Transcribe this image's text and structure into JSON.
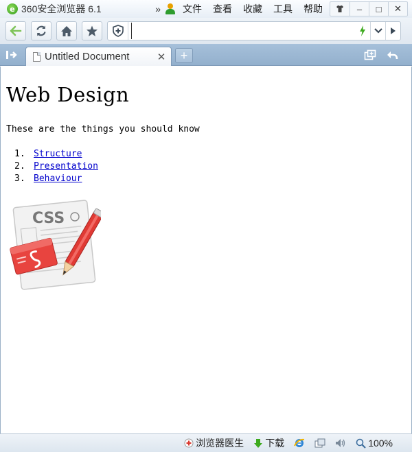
{
  "window": {
    "app_title": "360安全浏览器 6.1",
    "logo_letter": "e",
    "overflow_chevron": "»",
    "menus": [
      "文件",
      "查看",
      "收藏",
      "工具",
      "帮助"
    ],
    "controls": {
      "skin": "👕",
      "minimize": "–",
      "maximize": "□",
      "close": "✕"
    }
  },
  "toolbar": {
    "buttons": [
      "back-icon",
      "refresh-icon",
      "home-icon",
      "star-icon"
    ],
    "address": {
      "value": "",
      "placeholder": ""
    }
  },
  "tabs": {
    "items": [
      {
        "title": "Untitled Document",
        "close": "✕"
      }
    ],
    "new_tab": "+"
  },
  "page": {
    "heading": "Web Design",
    "intro": "These are the things you should know",
    "list": [
      {
        "num": "1.",
        "text": "Structure"
      },
      {
        "num": "2.",
        "text": "Presentation"
      },
      {
        "num": "3.",
        "text": "Behaviour"
      }
    ],
    "image_text": "CSS"
  },
  "statusbar": {
    "doctor": "浏览器医生",
    "download": "下载",
    "zoom": "100%"
  },
  "colors": {
    "tabbar": "#a6c0da",
    "link": "#0000cc",
    "accent_green": "#2e9c2e"
  }
}
